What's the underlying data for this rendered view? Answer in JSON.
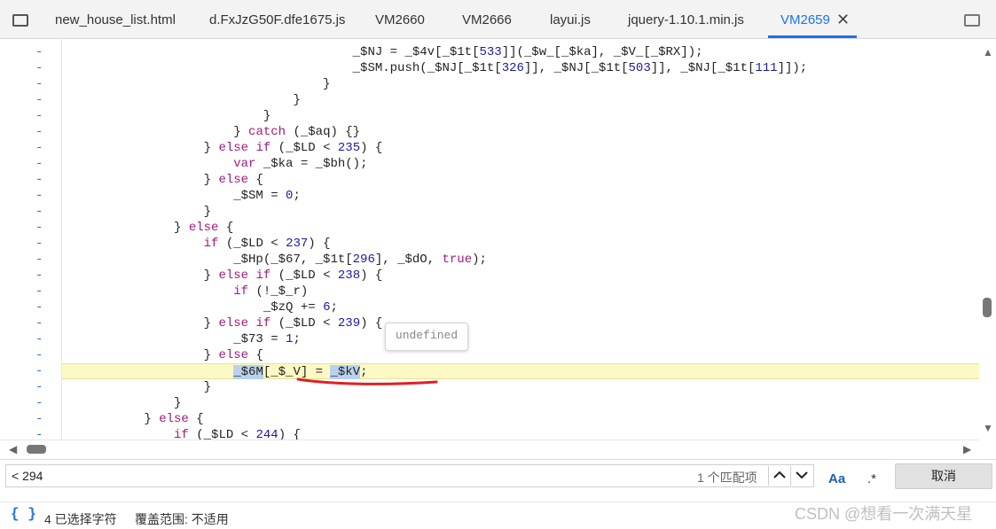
{
  "tabs": [
    {
      "label": "new_house_list.html"
    },
    {
      "label": "d.FxJzG50F.dfe1675.js"
    },
    {
      "label": "VM2660"
    },
    {
      "label": "VM2666"
    },
    {
      "label": "layui.js"
    },
    {
      "label": "jquery-1.10.1.min.js"
    },
    {
      "label": "VM2659",
      "active": true
    }
  ],
  "gutter_marker": "-",
  "code_lines": [
    "                                       _$NJ = _$4v[_$1t[533]](_$w_[_$ka], _$V_[_$RX]);",
    "                                       _$SM.push(_$NJ[_$1t[326]], _$NJ[_$1t[503]], _$NJ[_$1t[111]]);",
    "                                   }",
    "                               }",
    "                           }",
    "                       } catch (_$aq) {}",
    "                   } else if (_$LD < 235) {",
    "                       var _$ka = _$bh();",
    "                   } else {",
    "                       _$SM = 0;",
    "                   }",
    "               } else {",
    "                   if (_$LD < 237) {",
    "                       _$Hp(_$67, _$1t[296], _$dO, true);",
    "                   } else if (_$LD < 238) {",
    "                       if (!_$_r)",
    "                           _$zQ += 6;",
    "                   } else if (_$LD < 239) {",
    "                       _$73 = 1;",
    "                   } else {",
    "                       _$6M[_$_V] = _$kV;",
    "                   }",
    "               }",
    "           } else {",
    "               if (_$LD < 244) {"
  ],
  "tooltip_text": "undefined",
  "search": {
    "value": "< 294",
    "match_count": "1 个匹配项",
    "prev_icon": "chevron-up",
    "next_icon": "chevron-down",
    "case_label": "Aa",
    "regex_label": ".*",
    "cancel_label": "取消"
  },
  "status": {
    "braces": "{ }",
    "selected": "4 已选择字符",
    "coverage": "覆盖范围: 不适用"
  },
  "watermark": "CSDN @想看一次满天星",
  "colors": {
    "accent": "#1a73e8",
    "highlight_line": "#fdf9c4",
    "keyword": "#a0197e",
    "number": "#1a1aa6",
    "underline": "#e02020"
  }
}
